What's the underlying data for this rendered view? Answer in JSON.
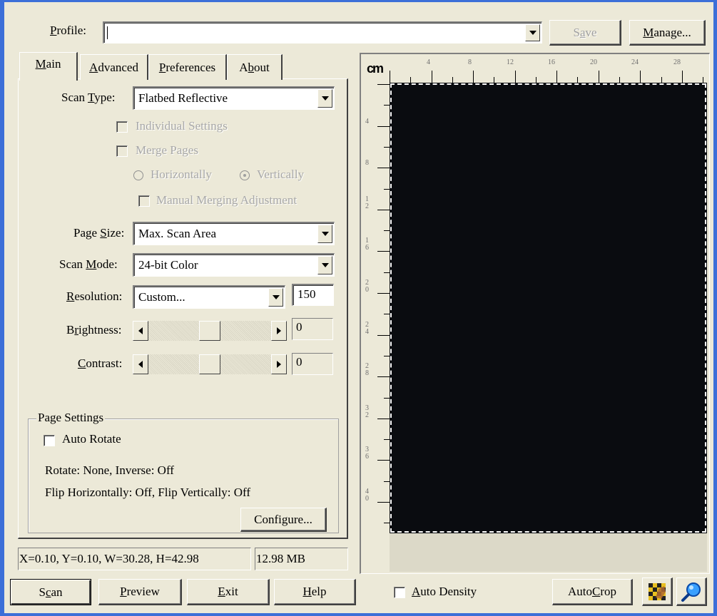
{
  "profile": {
    "label_pre": "",
    "label_ul": "P",
    "label_post": "rofile:",
    "value": "",
    "save_pre": "S",
    "save_ul": "a",
    "save_post": "ve",
    "manage_pre": "",
    "manage_ul": "M",
    "manage_post": "anage..."
  },
  "tabs": {
    "main": {
      "pre": "",
      "ul": "M",
      "post": "ain"
    },
    "advanced": {
      "pre": "",
      "ul": "A",
      "post": "dvanced"
    },
    "preferences": {
      "pre": "",
      "ul": "P",
      "post": "references"
    },
    "about": {
      "pre": "A",
      "ul": "b",
      "post": "out"
    }
  },
  "main": {
    "scan_type": {
      "label_pre": "Scan ",
      "label_ul": "T",
      "label_post": "ype:",
      "value": "Flatbed Reflective"
    },
    "individual_settings": "Individual Settings",
    "merge_pages": "Merge Pages",
    "horizontally": "Horizontally",
    "vertically": "Vertically",
    "manual_merging": "Manual Merging Adjustment",
    "page_size": {
      "label_pre": "Page ",
      "label_ul": "S",
      "label_post": "ize:",
      "value": "Max. Scan Area"
    },
    "scan_mode": {
      "label_pre": "Scan ",
      "label_ul": "M",
      "label_post": "ode:",
      "value": "24-bit Color"
    },
    "resolution": {
      "label_pre": "",
      "label_ul": "R",
      "label_post": "esolution:",
      "value": "Custom...",
      "number": "150"
    },
    "brightness": {
      "label_pre": "B",
      "label_ul": "r",
      "label_post": "ightness:",
      "value": "0",
      "level": 0.5
    },
    "contrast": {
      "label_pre": "",
      "label_ul": "C",
      "label_post": "ontrast:",
      "value": "0",
      "level": 0.5
    }
  },
  "page_settings": {
    "title": "Page Settings",
    "auto_rotate": "Auto Rotate",
    "rotate_line": "Rotate: None, Inverse: Off",
    "flip_line": "Flip Horizontally: Off, Flip Vertically: Off",
    "configure": "Configure..."
  },
  "status": {
    "coords": "X=0.10, Y=0.10, W=30.28, H=42.98",
    "size": "12.98 MB"
  },
  "ruler": {
    "unit": "cm",
    "top_ticks": [
      "4",
      "8",
      "12",
      "16",
      "20",
      "24",
      "28"
    ],
    "left_ticks": [
      "4",
      "8",
      "12",
      "16",
      "20",
      "24",
      "28",
      "32",
      "36",
      "40"
    ]
  },
  "buttons": {
    "scan": {
      "pre": "S",
      "ul": "c",
      "post": "an"
    },
    "preview": {
      "pre": "",
      "ul": "P",
      "post": "review"
    },
    "exit": {
      "pre": "",
      "ul": "E",
      "post": "xit"
    },
    "help": {
      "pre": "",
      "ul": "H",
      "post": "elp"
    },
    "auto_density": {
      "pre": "",
      "ul": "A",
      "post": "uto Density"
    },
    "auto_crop": {
      "pre": "Auto ",
      "ul": "C",
      "post": "rop"
    }
  },
  "colors": {
    "frame": "#3c6fd8",
    "preview_bg": "#0a0c10",
    "window_bg": "#ece9d8"
  }
}
